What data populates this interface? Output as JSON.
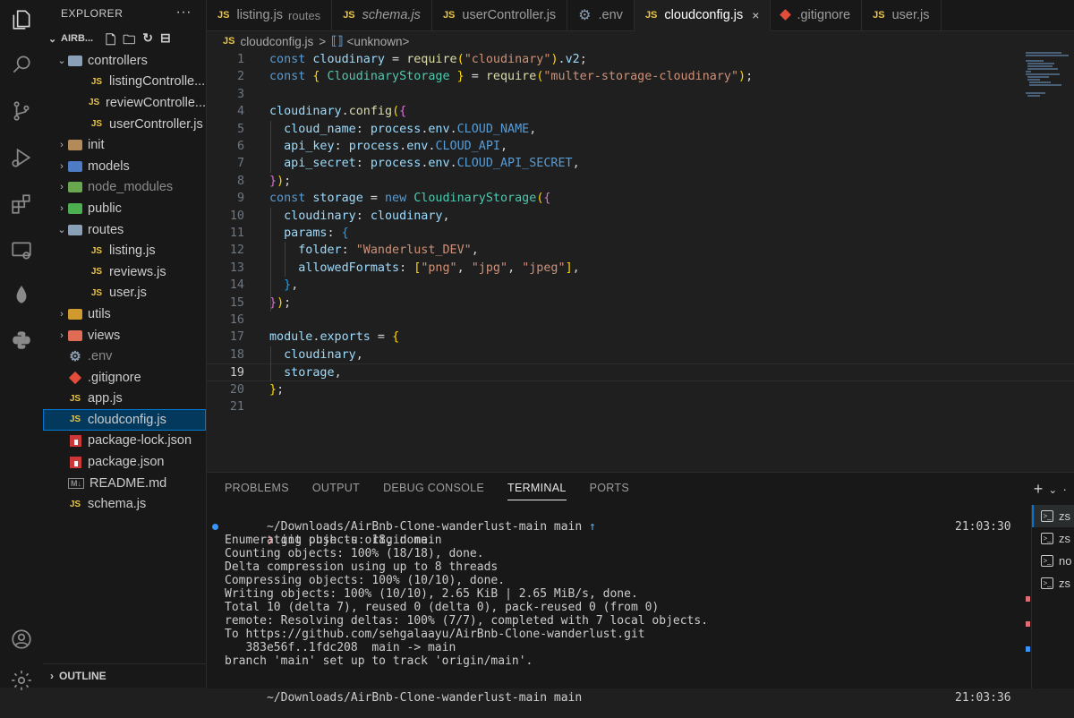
{
  "sidebar": {
    "title": "EXPLORER",
    "more": "···",
    "project": "AIRB...",
    "outline": "OUTLINE",
    "items": [
      {
        "label": "controllers",
        "type": "folder",
        "open": true,
        "indent": 0,
        "color": "#8aa0b7"
      },
      {
        "label": "listingControlle...",
        "type": "js",
        "indent": 1
      },
      {
        "label": "reviewControlle...",
        "type": "js",
        "indent": 1
      },
      {
        "label": "userController.js",
        "type": "js",
        "indent": 1
      },
      {
        "label": "init",
        "type": "folder",
        "open": false,
        "indent": 0,
        "color": "#b38a5a"
      },
      {
        "label": "models",
        "type": "folder",
        "open": false,
        "indent": 0,
        "color": "#4d7cc4"
      },
      {
        "label": "node_modules",
        "type": "folder",
        "open": false,
        "indent": 0,
        "color": "#6aa84f",
        "dim": true
      },
      {
        "label": "public",
        "type": "folder",
        "open": false,
        "indent": 0,
        "color": "#4caf50"
      },
      {
        "label": "routes",
        "type": "folder",
        "open": true,
        "indent": 0,
        "color": "#8aa0b7"
      },
      {
        "label": "listing.js",
        "type": "js",
        "indent": 1
      },
      {
        "label": "reviews.js",
        "type": "js",
        "indent": 1
      },
      {
        "label": "user.js",
        "type": "js",
        "indent": 1
      },
      {
        "label": "utils",
        "type": "folder",
        "open": false,
        "indent": 0,
        "color": "#d19a2e"
      },
      {
        "label": "views",
        "type": "folder",
        "open": false,
        "indent": 0,
        "color": "#e06c55"
      },
      {
        "label": ".env",
        "type": "gear",
        "indent": 0,
        "dim": true
      },
      {
        "label": ".gitignore",
        "type": "git",
        "indent": 0
      },
      {
        "label": "app.js",
        "type": "js",
        "indent": 0
      },
      {
        "label": "cloudconfig.js",
        "type": "js",
        "indent": 0,
        "selected": true
      },
      {
        "label": "package-lock.json",
        "type": "npm",
        "indent": 0
      },
      {
        "label": "package.json",
        "type": "npm",
        "indent": 0
      },
      {
        "label": "README.md",
        "type": "md",
        "indent": 0
      },
      {
        "label": "schema.js",
        "type": "js",
        "indent": 0
      }
    ]
  },
  "tabs": [
    {
      "label": "listing.js",
      "icon": "JS",
      "desc": "routes"
    },
    {
      "label": "schema.js",
      "icon": "JS",
      "italic": true
    },
    {
      "label": "userController.js",
      "icon": "JS"
    },
    {
      "label": ".env",
      "icon": "gear"
    },
    {
      "label": "cloudconfig.js",
      "icon": "JS",
      "active": true,
      "close": "×"
    },
    {
      "label": ".gitignore",
      "icon": "git"
    },
    {
      "label": "user.js",
      "icon": "JS"
    }
  ],
  "breadcrumb": {
    "file": "cloudconfig.js",
    "sep": ">",
    "symbol": "<unknown>"
  },
  "editor": {
    "current_line": 19,
    "lines": [
      [
        [
          "k",
          "const "
        ],
        [
          "v",
          "cloudinary"
        ],
        [
          "p",
          " = "
        ],
        [
          "f",
          "require"
        ],
        [
          "b1",
          "("
        ],
        [
          "s",
          "\"cloudinary\""
        ],
        [
          "b1",
          ")"
        ],
        [
          "p",
          "."
        ],
        [
          "v",
          "v2"
        ],
        [
          "p",
          ";"
        ]
      ],
      [
        [
          "k",
          "const "
        ],
        [
          "b1",
          "{ "
        ],
        [
          "c",
          "CloudinaryStorage"
        ],
        [
          "b1",
          " }"
        ],
        [
          "p",
          " = "
        ],
        [
          "f",
          "require"
        ],
        [
          "b1",
          "("
        ],
        [
          "s",
          "\"multer-storage-cloudinary\""
        ],
        [
          "b1",
          ")"
        ],
        [
          "p",
          ";"
        ]
      ],
      [],
      [
        [
          "v",
          "cloudinary"
        ],
        [
          "p",
          "."
        ],
        [
          "f",
          "config"
        ],
        [
          "b1",
          "("
        ],
        [
          "b2",
          "{"
        ]
      ],
      [
        [
          "p",
          "  "
        ],
        [
          "v",
          "cloud_name"
        ],
        [
          "p",
          ": "
        ],
        [
          "v",
          "process"
        ],
        [
          "p",
          "."
        ],
        [
          "v",
          "env"
        ],
        [
          "p",
          "."
        ],
        [
          "k",
          "CLOUD_NAME"
        ],
        [
          "p",
          ","
        ]
      ],
      [
        [
          "p",
          "  "
        ],
        [
          "v",
          "api_key"
        ],
        [
          "p",
          ": "
        ],
        [
          "v",
          "process"
        ],
        [
          "p",
          "."
        ],
        [
          "v",
          "env"
        ],
        [
          "p",
          "."
        ],
        [
          "k",
          "CLOUD_API"
        ],
        [
          "p",
          ","
        ]
      ],
      [
        [
          "p",
          "  "
        ],
        [
          "v",
          "api_secret"
        ],
        [
          "p",
          ": "
        ],
        [
          "v",
          "process"
        ],
        [
          "p",
          "."
        ],
        [
          "v",
          "env"
        ],
        [
          "p",
          "."
        ],
        [
          "k",
          "CLOUD_API_SECRET"
        ],
        [
          "p",
          ","
        ]
      ],
      [
        [
          "b2",
          "}"
        ],
        [
          "b1",
          ")"
        ],
        [
          "p",
          ";"
        ]
      ],
      [
        [
          "k",
          "const "
        ],
        [
          "v",
          "storage"
        ],
        [
          "p",
          " = "
        ],
        [
          "k",
          "new "
        ],
        [
          "c",
          "CloudinaryStorage"
        ],
        [
          "b1",
          "("
        ],
        [
          "b2",
          "{"
        ]
      ],
      [
        [
          "p",
          "  "
        ],
        [
          "v",
          "cloudinary"
        ],
        [
          "p",
          ": "
        ],
        [
          "v",
          "cloudinary"
        ],
        [
          "p",
          ","
        ]
      ],
      [
        [
          "p",
          "  "
        ],
        [
          "v",
          "params"
        ],
        [
          "p",
          ": "
        ],
        [
          "b3",
          "{"
        ]
      ],
      [
        [
          "p",
          "    "
        ],
        [
          "v",
          "folder"
        ],
        [
          "p",
          ": "
        ],
        [
          "s",
          "\"Wanderlust_DEV\""
        ],
        [
          "p",
          ","
        ]
      ],
      [
        [
          "p",
          "    "
        ],
        [
          "v",
          "allowedFormats"
        ],
        [
          "p",
          ": "
        ],
        [
          "b1",
          "["
        ],
        [
          "s",
          "\"png\""
        ],
        [
          "p",
          ", "
        ],
        [
          "s",
          "\"jpg\""
        ],
        [
          "p",
          ", "
        ],
        [
          "s",
          "\"jpeg\""
        ],
        [
          "b1",
          "]"
        ],
        [
          "p",
          ","
        ]
      ],
      [
        [
          "p",
          "  "
        ],
        [
          "b3",
          "}"
        ],
        [
          "p",
          ","
        ]
      ],
      [
        [
          "b2",
          "}"
        ],
        [
          "b1",
          ")"
        ],
        [
          "p",
          ";"
        ]
      ],
      [],
      [
        [
          "v",
          "module"
        ],
        [
          "p",
          "."
        ],
        [
          "v",
          "exports"
        ],
        [
          "p",
          " = "
        ],
        [
          "b1",
          "{"
        ]
      ],
      [
        [
          "p",
          "  "
        ],
        [
          "v",
          "cloudinary"
        ],
        [
          "p",
          ","
        ]
      ],
      [
        [
          "p",
          "  "
        ],
        [
          "v",
          "storage"
        ],
        [
          "p",
          ","
        ]
      ],
      [
        [
          "b1",
          "}"
        ],
        [
          "p",
          ";"
        ]
      ],
      []
    ]
  },
  "panel": {
    "tabs": [
      "PROBLEMS",
      "OUTPUT",
      "DEBUG CONSOLE",
      "TERMINAL",
      "PORTS"
    ],
    "active_tab": "TERMINAL",
    "actions": "+ ⌄ ·",
    "prompt": {
      "path": "~/Downloads/AirBnb-Clone-wanderlust-main",
      "branch": "main",
      "arrow": "↑",
      "time": "21:03:30"
    },
    "command": "git push -u origin main",
    "output": [
      "Enumerating objects: 18, done.",
      "Counting objects: 100% (18/18), done.",
      "Delta compression using up to 8 threads",
      "Compressing objects: 100% (10/10), done.",
      "Writing objects: 100% (10/10), 2.65 KiB | 2.65 MiB/s, done.",
      "Total 10 (delta 7), reused 0 (delta 0), pack-reused 0 (from 0)",
      "remote: Resolving deltas: 100% (7/7), completed with 7 local objects.",
      "To https://github.com/sehgalaayu/AirBnb-Clone-wanderlust.git",
      "   383e56f..1fdc208  main -> main",
      "branch 'main' set up to track 'origin/main'."
    ],
    "prompt2": {
      "path": "~/Downloads/AirBnb-Clone-wanderlust-main",
      "branch": "main",
      "time": "21:03:36"
    },
    "terminals": [
      "zs",
      "zs",
      "no",
      "zs"
    ]
  }
}
